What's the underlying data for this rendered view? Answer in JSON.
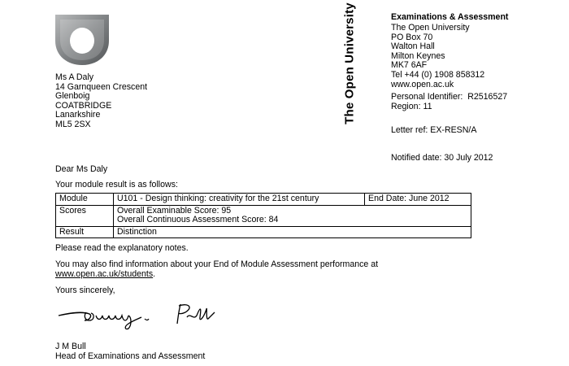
{
  "logo": {
    "icon": "open-university-shield-icon",
    "color": "#7f8284"
  },
  "brand_text": "The Open University",
  "sender": {
    "dept": "Examinations & Assessment",
    "lines": [
      "The Open University",
      "PO Box 70",
      "Walton Hall",
      "Milton Keynes",
      "MK7 6AF"
    ],
    "tel": "Tel +44 (0) 1908 858312",
    "web": "www.open.ac.uk",
    "pi_label": "Personal Identifier:",
    "pi_value": "R2516527",
    "region": "Region: 11",
    "letter_ref": "Letter ref: EX-RESN/A",
    "notified": "Notified date: 30 July 2012"
  },
  "recipient": {
    "lines": [
      "Ms A Daly",
      "14 Garnqueen Crescent",
      "Glenboig",
      "COATBRIDGE",
      "Lanarkshire",
      "ML5 2SX"
    ]
  },
  "body": {
    "salutation": "Dear Ms Daly",
    "intro": "Your module result is as follows:",
    "read_notes": "Please read the explanatory notes.",
    "info_line1": "You may also find information about your End of Module Assessment performance at",
    "info_link": "www.open.ac.uk/students",
    "info_tail": ".",
    "closing": "Yours sincerely,",
    "signatory_name": "J M Bull",
    "signatory_title": "Head of Examinations and Assessment"
  },
  "table": {
    "module_label": "Module",
    "module_value": "U101 - Design thinking: creativity for the 21st century",
    "end_date": "End Date: June 2012",
    "scores_label": "Scores",
    "score1": "Overall Examinable Score: 95",
    "score2": "Overall Continuous Assessment Score: 84",
    "result_label": "Result",
    "result_value": "Distinction"
  }
}
